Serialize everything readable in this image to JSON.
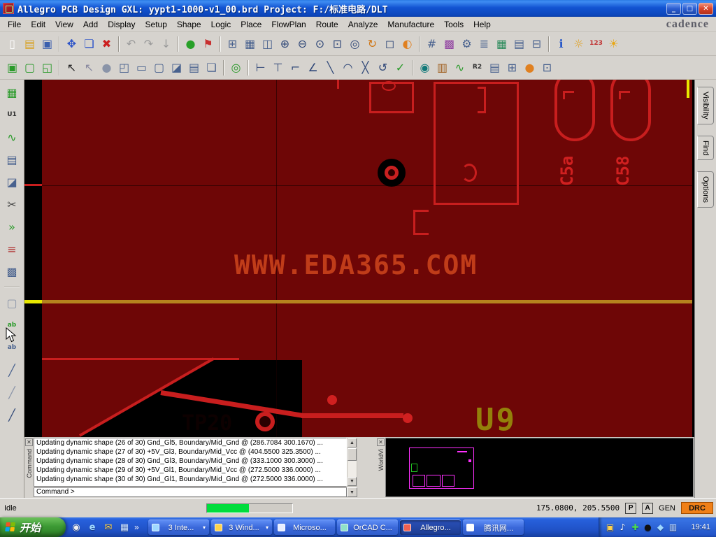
{
  "window": {
    "title": "Allegro PCB Design GXL:  yypt1-1000-v1_00.brd  Project: F:/标准电路/DLT",
    "buttons": {
      "minimize": "_",
      "maximize": "□",
      "close": "✕"
    }
  },
  "brand": "cadence",
  "menu": {
    "items": [
      "File",
      "Edit",
      "View",
      "Add",
      "Display",
      "Setup",
      "Shape",
      "Logic",
      "Place",
      "FlowPlan",
      "Route",
      "Analyze",
      "Manufacture",
      "Tools",
      "Help"
    ]
  },
  "toolbar_row1": [
    {
      "name": "new-drawing-icon",
      "glyph": "▯",
      "color": "#ffffff"
    },
    {
      "name": "open-drawing-icon",
      "glyph": "▤",
      "color": "#d8a020"
    },
    {
      "name": "save-drawing-icon",
      "glyph": "▣",
      "color": "#3a5fae"
    },
    {
      "sep": true
    },
    {
      "name": "move-icon",
      "glyph": "✥",
      "color": "#2850c8"
    },
    {
      "name": "copy-icon",
      "glyph": "❏",
      "color": "#2850c8"
    },
    {
      "name": "delete-icon",
      "glyph": "✖",
      "color": "#cc2020"
    },
    {
      "sep": true
    },
    {
      "name": "undo-icon",
      "glyph": "↶",
      "color": "#9a9a9a"
    },
    {
      "name": "redo-icon",
      "glyph": "↷",
      "color": "#9a9a9a"
    },
    {
      "name": "cancel-icon",
      "glyph": "↓",
      "color": "#9a9a9a"
    },
    {
      "sep": true
    },
    {
      "name": "highlight-icon",
      "glyph": "●",
      "color": "#28a028"
    },
    {
      "name": "pin-icon",
      "glyph": "⚑",
      "color": "#c83030"
    },
    {
      "sep": true
    },
    {
      "name": "grid-icon",
      "glyph": "⊞",
      "color": "#48618e"
    },
    {
      "name": "setup-board-icon",
      "glyph": "▦",
      "color": "#48618e"
    },
    {
      "name": "padstack-icon",
      "glyph": "◫",
      "color": "#48618e"
    },
    {
      "name": "zoom-in-icon",
      "glyph": "⊕",
      "color": "#304878"
    },
    {
      "name": "zoom-out-icon",
      "glyph": "⊖",
      "color": "#304878"
    },
    {
      "name": "zoom-points-icon",
      "glyph": "⊙",
      "color": "#304878"
    },
    {
      "name": "zoom-fit-icon",
      "glyph": "⊡",
      "color": "#304878"
    },
    {
      "name": "zoom-world-icon",
      "glyph": "◎",
      "color": "#304878"
    },
    {
      "name": "redraw-icon",
      "glyph": "↻",
      "color": "#d07818"
    },
    {
      "name": "window-select-icon",
      "glyph": "◻",
      "color": "#304878"
    },
    {
      "name": "shadow-mode-icon",
      "glyph": "◐",
      "color": "#e08020"
    },
    {
      "sep": true
    },
    {
      "name": "grid-toggle-icon",
      "glyph": "#",
      "color": "#48618e"
    },
    {
      "name": "color-dialog-icon",
      "glyph": "▩",
      "color": "#9040a0"
    },
    {
      "name": "gears-icon",
      "glyph": "⚙",
      "color": "#48618e"
    },
    {
      "name": "cross-section-icon",
      "glyph": "≣",
      "color": "#48618e"
    },
    {
      "name": "spreadsheet-icon",
      "glyph": "▦",
      "color": "#2a8a5a"
    },
    {
      "name": "layers-icon",
      "glyph": "▤",
      "color": "#48618e"
    },
    {
      "name": "properties-icon",
      "glyph": "⊟",
      "color": "#48618e"
    },
    {
      "sep": true
    },
    {
      "name": "help-info-icon",
      "glyph": "ℹ",
      "color": "#2858c8"
    },
    {
      "name": "tip-icon",
      "glyph": "☼",
      "color": "#e0a020"
    },
    {
      "name": "numbers-icon",
      "glyph": "123",
      "color": "#c03030"
    },
    {
      "name": "daylight-icon",
      "glyph": "☀",
      "color": "#e8a818"
    }
  ],
  "toolbar_row2": [
    {
      "name": "shape-select-icon",
      "glyph": "▣",
      "color": "#2a9a2a"
    },
    {
      "name": "shape-polygon-icon",
      "glyph": "▢",
      "color": "#2a9a2a"
    },
    {
      "name": "shape-rect-icon",
      "glyph": "◱",
      "color": "#2a9a2a"
    },
    {
      "sep": true
    },
    {
      "name": "pick-arrow-icon",
      "glyph": "↖",
      "color": "#222222"
    },
    {
      "name": "pick-alt-icon",
      "glyph": "↖",
      "color": "#8a8aa0"
    },
    {
      "name": "circle-select-icon",
      "glyph": "●",
      "color": "#8a94a8"
    },
    {
      "name": "pick-box-icon",
      "glyph": "◰",
      "color": "#48618e"
    },
    {
      "name": "rect-tool-icon",
      "glyph": "▭",
      "color": "#48618e"
    },
    {
      "name": "rounded-rect-icon",
      "glyph": "▢",
      "color": "#48618e"
    },
    {
      "name": "slanted-rect-icon",
      "glyph": "◪",
      "color": "#48618e"
    },
    {
      "name": "stack-icon",
      "glyph": "▤",
      "color": "#48618e"
    },
    {
      "name": "overlap-icon",
      "glyph": "❏",
      "color": "#48618e"
    },
    {
      "sep": true
    },
    {
      "name": "target-icon",
      "glyph": "◎",
      "color": "#2a9a2a"
    },
    {
      "sep": true
    },
    {
      "name": "measure-icon",
      "glyph": "⊢",
      "color": "#304878"
    },
    {
      "name": "dimension-icon",
      "glyph": "⊤",
      "color": "#304878"
    },
    {
      "name": "chamfer-icon",
      "glyph": "⌐",
      "color": "#304878"
    },
    {
      "name": "angle-icon",
      "glyph": "∠",
      "color": "#304878"
    },
    {
      "name": "line-tool-icon",
      "glyph": "╲",
      "color": "#304878"
    },
    {
      "name": "arc-tool-icon",
      "glyph": "◠",
      "color": "#304878"
    },
    {
      "name": "cross-tool-icon",
      "glyph": "╳",
      "color": "#304878"
    },
    {
      "name": "spin-tool-icon",
      "glyph": "↺",
      "color": "#304878"
    },
    {
      "name": "check-icon",
      "glyph": "✓",
      "color": "#2a9a2a"
    },
    {
      "sep": true
    },
    {
      "name": "odb-icon",
      "glyph": "◉",
      "color": "#107878"
    },
    {
      "name": "library-icon",
      "glyph": "▥",
      "color": "#a06020"
    },
    {
      "name": "signal-probe-icon",
      "glyph": "∿",
      "color": "#2a9a2a"
    },
    {
      "name": "refdes-icon",
      "glyph": "R2",
      "color": "#303030"
    },
    {
      "name": "layer-stack-icon",
      "glyph": "▤",
      "color": "#48618e"
    },
    {
      "name": "pin-grid-icon",
      "glyph": "⊞",
      "color": "#48618e"
    },
    {
      "name": "dot-icon",
      "glyph": "●",
      "color": "#e08020"
    },
    {
      "name": "fpga-icon",
      "glyph": "⊡",
      "color": "#48618e"
    }
  ],
  "left_toolbar": [
    {
      "name": "board-visibility-icon",
      "glyph": "▦",
      "color": "#2a9a2a"
    },
    {
      "name": "symbol-u1-icon",
      "glyph": "U1",
      "color": "#303030"
    },
    {
      "name": "waveform-icon",
      "glyph": "∿",
      "color": "#2a9a2a"
    },
    {
      "name": "report-icon",
      "glyph": "▤",
      "color": "#48618e"
    },
    {
      "name": "shape-edit-icon",
      "glyph": "◪",
      "color": "#48618e"
    },
    {
      "name": "cut-icon",
      "glyph": "✂",
      "color": "#444444"
    },
    {
      "name": "shove-icon",
      "glyph": "»",
      "color": "#2a9a2a"
    },
    {
      "name": "list-icon",
      "glyph": "≡",
      "color": "#b03030"
    },
    {
      "name": "pattern-icon",
      "glyph": "▩",
      "color": "#48618e"
    },
    {
      "sep": true
    },
    {
      "name": "select-box-icon",
      "glyph": "▢",
      "color": "#8a94a8"
    },
    {
      "name": "text-add-icon",
      "glyph": "ab",
      "color": "#2a9a2a"
    },
    {
      "name": "text-edit-icon",
      "glyph": "ab",
      "color": "#48618e"
    },
    {
      "name": "route-slant-icon",
      "glyph": "╱",
      "color": "#48618e"
    },
    {
      "name": "route-slant2-icon",
      "glyph": "╱",
      "color": "#8a94a8"
    },
    {
      "name": "route-slant3-icon",
      "glyph": "╱",
      "color": "#304878"
    }
  ],
  "right_tabs": [
    "Visibility",
    "Find",
    "Options"
  ],
  "canvas": {
    "watermark": "WWW.EDA365.COM",
    "ref_c5a": "C5a",
    "ref_c58": "C58",
    "ref_tp20": "TP20",
    "ref_u9": "U9"
  },
  "console": {
    "title": "Command",
    "close": "✕",
    "lines": [
      "Updating dynamic shape (26 of 30) Gnd_Gl5, Boundary/Mid_Gnd @ (286.7084 300.1670) ...",
      "Updating dynamic shape (27 of 30) +5V_Gl3, Boundary/Mid_Vcc @ (404.5500 325.3500) ...",
      "Updating dynamic shape (28 of 30) Gnd_Gl3, Boundary/Mid_Gnd @ (333.1000 300.3000) ...",
      "Updating dynamic shape (29 of 30) +5V_Gl1, Boundary/Mid_Vcc @ (272.5000 336.0000) ...",
      "Updating dynamic shape (30 of 30) Gnd_Gl1, Boundary/Mid_Gnd @ (272.5000 336.0000) ..."
    ],
    "prompt": "Command >"
  },
  "worldview": {
    "title": "WorldVi",
    "close": "✕"
  },
  "statusbar": {
    "state": "Idle",
    "coords": "175.0800, 205.5500",
    "pick": "P",
    "app": "A",
    "gen": "GEN",
    "drc": "DRC",
    "progress_color": "#00dd3c",
    "drc_color": "#f08018"
  },
  "taskbar": {
    "start": "开始",
    "overflow": "»",
    "quicklaunch": [
      {
        "name": "quicklaunch-media-icon",
        "glyph": "◉",
        "color": "#f0f0f0"
      },
      {
        "name": "quicklaunch-ie-icon",
        "glyph": "e",
        "color": "#9fd8ff"
      },
      {
        "name": "quicklaunch-mail-icon",
        "glyph": "✉",
        "color": "#ffd24a"
      },
      {
        "name": "quicklaunch-desktop-icon",
        "glyph": "▦",
        "color": "#cfe4ff"
      }
    ],
    "tasks": [
      {
        "label": "3 Inte...",
        "icon_color": "#9fd8ff",
        "arrow": true
      },
      {
        "label": "3 Wind...",
        "icon_color": "#ffd24a",
        "arrow": true
      },
      {
        "label": "Microso...",
        "icon_color": "#e8eeff",
        "arrow": false
      },
      {
        "label": "OrCAD C...",
        "icon_color": "#8fe0c8",
        "arrow": false
      },
      {
        "label": "Allegro...",
        "icon_color": "#f06050",
        "arrow": false,
        "active": true
      },
      {
        "label": "腾讯网...",
        "icon_color": "#ffffff",
        "arrow": false
      }
    ],
    "tray_icons": [
      {
        "name": "tray-update-icon",
        "glyph": "▣",
        "color": "#ffd24a"
      },
      {
        "name": "tray-volume-icon",
        "glyph": "♪",
        "color": "#ffffff"
      },
      {
        "name": "tray-shield-icon",
        "glyph": "✚",
        "color": "#4ce04c"
      },
      {
        "name": "tray-qq-icon",
        "glyph": "●",
        "color": "#101010"
      },
      {
        "name": "tray-msg-icon",
        "glyph": "◆",
        "color": "#9fd8ff"
      },
      {
        "name": "tray-network-icon",
        "glyph": "▥",
        "color": "#cfe4ff"
      }
    ],
    "time": "19:41"
  },
  "colors": {
    "pcb_pour": "#6e0606",
    "pcb_outline": "#c81e1e",
    "watermark": "#d2491e",
    "worldview_outline": "#ff30ff"
  }
}
